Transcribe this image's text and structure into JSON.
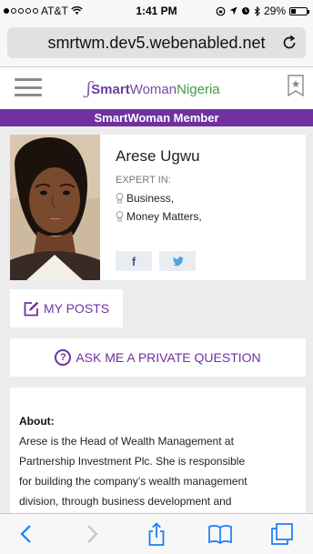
{
  "status_bar": {
    "carrier": "AT&T",
    "time": "1:41 PM",
    "battery": "29%",
    "battery_level": 0.29
  },
  "browser": {
    "url": "smrtwm.dev5.webenabled.net"
  },
  "site": {
    "logo": {
      "smart": "Smart",
      "woman": "Woman",
      "nigeria": "Nigeria"
    },
    "banner": "SmartWoman Member"
  },
  "profile": {
    "name": "Arese Ugwu",
    "expert_label": "EXPERT IN:",
    "expertise": [
      "Business,",
      "Money Matters,"
    ],
    "social": {
      "facebook": "f",
      "twitter": "t"
    }
  },
  "actions": {
    "my_posts": "MY POSTS",
    "ask_question": "ASK ME A PRIVATE QUESTION"
  },
  "about": {
    "title": "About:",
    "lines": [
      "Arese is the Head of Wealth Management at",
      "Partnership Investment Plc. She is responsible",
      "for building the company’s wealth management",
      "division, through business development and"
    ]
  },
  "colors": {
    "accent": "#7030a0",
    "logo_green": "#3e9e42",
    "ios_blue": "#147efb"
  }
}
